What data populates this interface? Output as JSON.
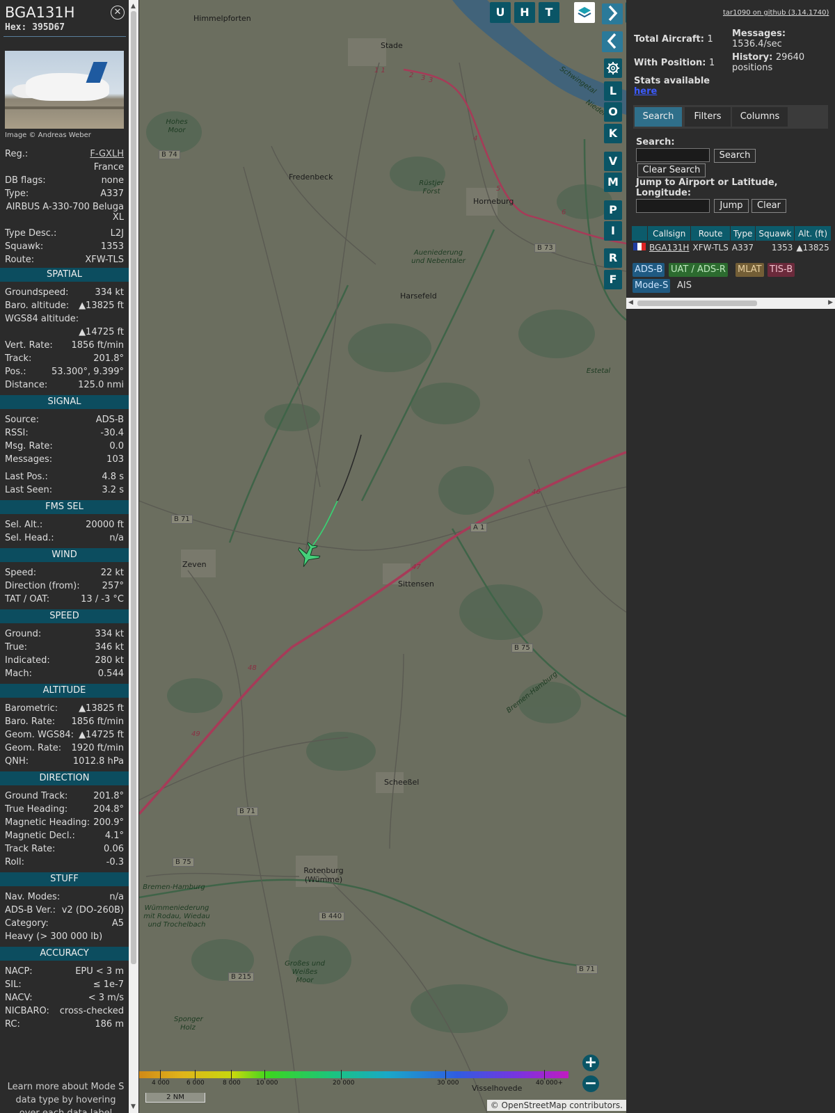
{
  "sidebar": {
    "callsign": "BGA131H",
    "hex_label": "Hex:",
    "hex": "395D67",
    "close_glyph": "✕",
    "photo_credit": "Image © Andreas Weber",
    "details": [
      {
        "k": "Reg.:",
        "v": "F-GXLH"
      },
      {
        "k": "",
        "v": "France"
      },
      {
        "k": "DB flags:",
        "v": "none"
      },
      {
        "k": "Type:",
        "v": "A337"
      },
      {
        "k": "",
        "v": "AIRBUS A-330-700 Beluga"
      },
      {
        "k": "",
        "v": "XL"
      },
      {
        "k": "Type Desc.:",
        "v": "L2J"
      },
      {
        "k": "Squawk:",
        "v": "1353"
      },
      {
        "k": "Route:",
        "v": "XFW-TLS"
      }
    ],
    "sections": [
      {
        "title": "SPATIAL",
        "rows": [
          {
            "k": "Groundspeed:",
            "v": "334 kt"
          },
          {
            "k": "Baro. altitude:",
            "v": "▲13825 ft"
          },
          {
            "k": "WGS84 altitude:",
            "v": ""
          },
          {
            "k": "",
            "v": "▲14725 ft"
          },
          {
            "k": "Vert. Rate:",
            "v": "1856 ft/min"
          },
          {
            "k": "Track:",
            "v": "201.8°"
          },
          {
            "k": "Pos.:",
            "v": "53.300°, 9.399°"
          },
          {
            "k": "Distance:",
            "v": "125.0 nmi"
          }
        ]
      },
      {
        "title": "SIGNAL",
        "rows": [
          {
            "k": "Source:",
            "v": "ADS-B"
          },
          {
            "k": "RSSI:",
            "v": "-30.4"
          },
          {
            "k": "Msg. Rate:",
            "v": "0.0"
          },
          {
            "k": "Messages:",
            "v": "103"
          },
          {
            "k": "Last Pos.:",
            "v": "4.8 s"
          },
          {
            "k": "Last Seen:",
            "v": "3.2 s"
          }
        ]
      },
      {
        "title": "FMS SEL",
        "rows": [
          {
            "k": "Sel. Alt.:",
            "v": "20000 ft"
          },
          {
            "k": "Sel. Head.:",
            "v": "n/a"
          }
        ]
      },
      {
        "title": "WIND",
        "rows": [
          {
            "k": "Speed:",
            "v": "22 kt"
          },
          {
            "k": "Direction (from):",
            "v": "257°"
          },
          {
            "k": "TAT / OAT:",
            "v": "13 / -3 °C"
          }
        ]
      },
      {
        "title": "SPEED",
        "rows": [
          {
            "k": "Ground:",
            "v": "334 kt"
          },
          {
            "k": "True:",
            "v": "346 kt"
          },
          {
            "k": "Indicated:",
            "v": "280 kt"
          },
          {
            "k": "Mach:",
            "v": "0.544"
          }
        ]
      },
      {
        "title": "ALTITUDE",
        "rows": [
          {
            "k": "Barometric:",
            "v": "▲13825 ft"
          },
          {
            "k": "Baro. Rate:",
            "v": "1856 ft/min"
          },
          {
            "k": "Geom. WGS84:",
            "v": "▲14725 ft"
          },
          {
            "k": "Geom. Rate:",
            "v": "1920 ft/min"
          },
          {
            "k": "QNH:",
            "v": "1012.8 hPa"
          }
        ]
      },
      {
        "title": "DIRECTION",
        "rows": [
          {
            "k": "Ground Track:",
            "v": "201.8°"
          },
          {
            "k": "True Heading:",
            "v": "204.8°"
          },
          {
            "k": "Magnetic Heading:",
            "v": "200.9°"
          },
          {
            "k": "Magnetic Decl.:",
            "v": "4.1°"
          },
          {
            "k": "Track Rate:",
            "v": "0.06"
          },
          {
            "k": "Roll:",
            "v": "-0.3"
          }
        ]
      },
      {
        "title": "STUFF",
        "rows": [
          {
            "k": "Nav. Modes:",
            "v": "n/a"
          },
          {
            "k": "ADS-B Ver.:",
            "v": "v2 (DO-260B)"
          },
          {
            "k": "Category:",
            "v": "A5"
          },
          {
            "k": "Heavy (> 300 000 lb)",
            "v": ""
          }
        ]
      },
      {
        "title": "ACCURACY",
        "rows": [
          {
            "k": "NACP:",
            "v": "EPU < 3 m"
          },
          {
            "k": "SIL:",
            "v": "≤ 1e-7"
          },
          {
            "k": "NACV:",
            "v": "< 3 m/s"
          },
          {
            "k": "NICBARO:",
            "v": "cross-checked"
          },
          {
            "k": "RC:",
            "v": "186 m"
          }
        ]
      }
    ],
    "footer_note": "Learn more about Mode S data type by hovering over each data label"
  },
  "map": {
    "buttons": [
      "U",
      "H",
      "T"
    ],
    "side_buttons": [
      "L",
      "O",
      "K",
      "V",
      "M",
      "P",
      "I",
      "R",
      "F"
    ],
    "places": [
      {
        "name": "Himmelpforten"
      },
      {
        "name": "Stade"
      },
      {
        "name": "Fredenbeck"
      },
      {
        "name": "Horneburg"
      },
      {
        "name": "Harsefeld"
      },
      {
        "name": "Zeven"
      },
      {
        "name": "Sittensen"
      },
      {
        "name": "Scheeßel"
      },
      {
        "name": "Rotenburg (Wümme)"
      },
      {
        "name": "Visselhovede"
      }
    ],
    "area_labels": [
      "Hohes Moor",
      "Rüstjer Forst",
      "Aueniederung und Nebentaler",
      "Wümmeniederung mit Rodau, Wiedau und Trochelbach",
      "Großes und Weißes Moor",
      "Sponger Holz",
      "Bremen-Hamburg",
      "Bremen-Hamburg",
      "Estetal",
      "Schwingetal",
      "Nieder"
    ],
    "road_labels": [
      "B 74",
      "B 73",
      "B 71",
      "A 1",
      "B 75",
      "B 71",
      "B 75",
      "B 440",
      "B 215",
      "B 71",
      "47",
      "48",
      "49",
      "46",
      "4",
      "5",
      "6",
      "1 1",
      "2",
      "3",
      "3"
    ],
    "altitude_scale": [
      "4 000",
      "6 000",
      "8 000",
      "10 000",
      "20 000",
      "30 000",
      "40 000+"
    ],
    "scale_bar": "2 NM",
    "attribution": "© OpenStreetMap contributors.",
    "zoom_in": "+",
    "zoom_out": "−"
  },
  "right": {
    "github": "tar1090 on github (3.14.1740)",
    "total_aircraft_label": "Total Aircraft:",
    "total_aircraft": "1",
    "with_position_label": "With Position:",
    "with_position": "1",
    "messages_label": "Messages:",
    "messages": "1536.4/sec",
    "history_label": "History:",
    "history": "29640 positions",
    "stats_label": "Stats available",
    "stats_link": "here",
    "tabs": [
      "Search",
      "Filters",
      "Columns"
    ],
    "search_label": "Search:",
    "search_button": "Search",
    "clear_search_button": "Clear Search",
    "jump_label": "Jump to Airport or Latitude, Longitude:",
    "jump_button": "Jump",
    "clear_button": "Clear",
    "table_headers": [
      "",
      "Callsign",
      "Route",
      "Type",
      "Squawk",
      "Alt. (ft)"
    ],
    "table_rows": [
      {
        "flag": "",
        "callsign": "BGA131H",
        "route": "XFW-TLS",
        "type": "A337",
        "squawk": "1353",
        "alt": "▲13825"
      }
    ],
    "sources": [
      "ADS-B",
      "UAT / ADS-R",
      "MLAT",
      "TIS-B",
      "Mode-S",
      "AIS"
    ],
    "source_colors": [
      "#1f5a82",
      "#2c6b2f",
      "#735e36",
      "#6b2a3b",
      "#1f5a82",
      "#2c2c2c"
    ]
  }
}
